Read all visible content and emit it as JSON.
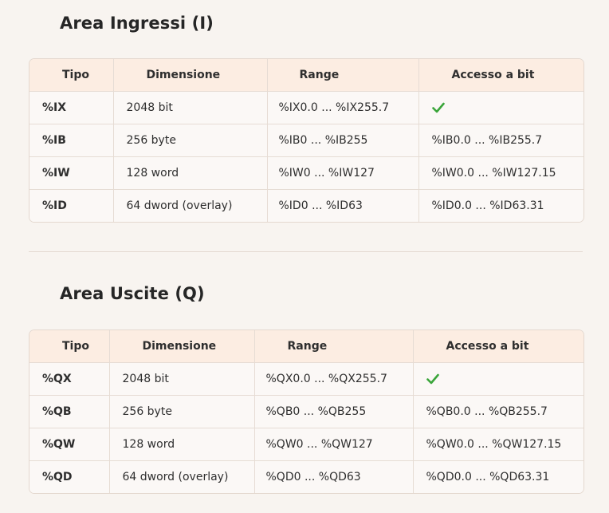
{
  "input_area": {
    "title": "Area Ingressi (I)",
    "headers": {
      "tipo": "Tipo",
      "dimensione": "Dimensione",
      "range": "Range",
      "accesso": "Accesso a bit"
    },
    "rows": [
      {
        "tipo": "%IX",
        "dimensione": "2048 bit",
        "range": "%IX0.0 ... %IX255.7",
        "accesso": "",
        "accesso_icon": "check-icon"
      },
      {
        "tipo": "%IB",
        "dimensione": "256 byte",
        "range": "%IB0 ... %IB255",
        "accesso": "%IB0.0 ... %IB255.7"
      },
      {
        "tipo": "%IW",
        "dimensione": "128 word",
        "range": "%IW0 ... %IW127",
        "accesso": "%IW0.0 ... %IW127.15"
      },
      {
        "tipo": "%ID",
        "dimensione": "64 dword (overlay)",
        "range": "%ID0 ... %ID63",
        "accesso": "%ID0.0 ... %ID63.31"
      }
    ]
  },
  "output_area": {
    "title": "Area Uscite (Q)",
    "headers": {
      "tipo": "Tipo",
      "dimensione": "Dimensione",
      "range": "Range",
      "accesso": "Accesso a bit"
    },
    "rows": [
      {
        "tipo": "%QX",
        "dimensione": "2048 bit",
        "range": "%QX0.0 ... %QX255.7",
        "accesso": "",
        "accesso_icon": "check-icon"
      },
      {
        "tipo": "%QB",
        "dimensione": "256 byte",
        "range": "%QB0 ... %QB255",
        "accesso": "%QB0.0 ... %QB255.7"
      },
      {
        "tipo": "%QW",
        "dimensione": "128 word",
        "range": "%QW0 ... %QW127",
        "accesso": "%QW0.0 ... %QW127.15"
      },
      {
        "tipo": "%QD",
        "dimensione": "64 dword (overlay)",
        "range": "%QD0 ... %QD63",
        "accesso": "%QD0.0 ... %QD63.31"
      }
    ]
  },
  "colors": {
    "background": "#f8f4f0",
    "header_bg": "#fcede2",
    "check": "#3aa53a"
  }
}
